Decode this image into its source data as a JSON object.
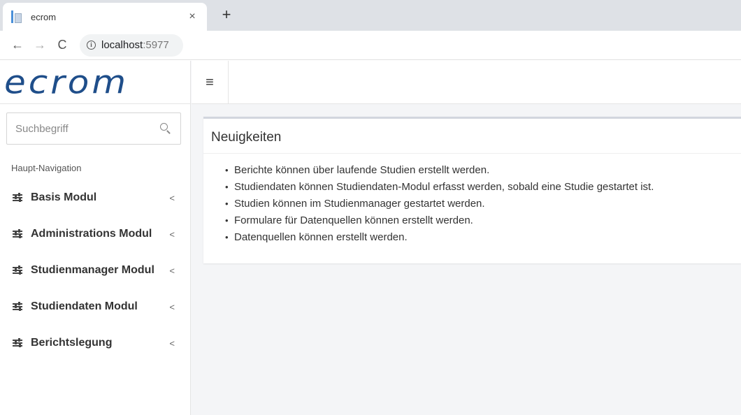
{
  "browser": {
    "tab_title": "ecrom",
    "tab_close": "×",
    "new_tab": "+",
    "back": "←",
    "forward": "→",
    "reload": "C",
    "url_host": "localhost",
    "url_port": ":5977",
    "info_icon": "i"
  },
  "app": {
    "logo": "ecrom",
    "logo_color": "#1f4e8a",
    "search": {
      "placeholder": "Suchbegriff"
    },
    "nav_header": "Haupt-Navigation",
    "nav_items": [
      {
        "label": "Basis Modul",
        "chevron": "<"
      },
      {
        "label": "Administrations Modul",
        "chevron": "<"
      },
      {
        "label": "Studienmanager Modul",
        "chevron": "<"
      },
      {
        "label": "Studiendaten Modul",
        "chevron": "<"
      },
      {
        "label": "Berichtslegung",
        "chevron": "<"
      }
    ],
    "hamburger": "≡",
    "news": {
      "title": "Neuigkeiten",
      "items": [
        "Berichte können über laufende Studien erstellt werden.",
        "Studiendaten können Studiendaten-Modul erfasst werden, sobald eine Studie gestartet ist.",
        "Studien können im Studienmanager gestartet werden.",
        "Formulare für Datenquellen können erstellt werden.",
        "Datenquellen können erstellt werden."
      ]
    }
  }
}
